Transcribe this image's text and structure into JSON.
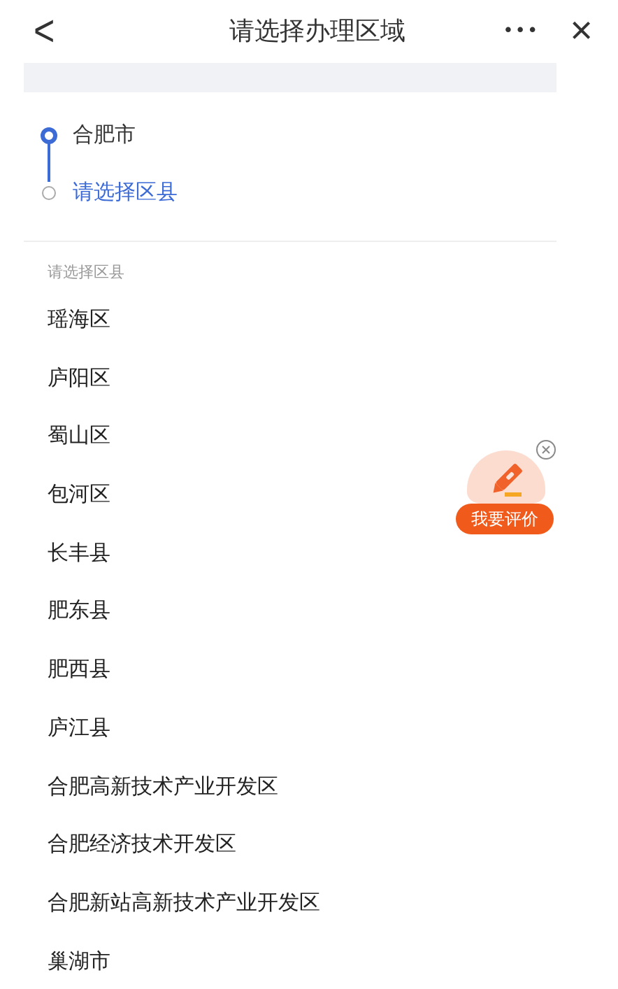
{
  "header": {
    "back": "<",
    "title": "请选择办理区域",
    "more": "•••",
    "close": "×"
  },
  "steps": [
    {
      "label": "合肥市",
      "selected": false
    },
    {
      "label": "请选择区县",
      "selected": true
    }
  ],
  "list": {
    "heading": "请选择区县",
    "items": [
      {
        "label": "瑶海区"
      },
      {
        "label": "庐阳区"
      },
      {
        "label": "蜀山区"
      },
      {
        "label": "包河区"
      },
      {
        "label": "长丰县"
      },
      {
        "label": "肥东县"
      },
      {
        "label": "肥西县"
      },
      {
        "label": "庐江县"
      },
      {
        "label": "合肥高新技术产业开发区"
      },
      {
        "label": "合肥经济技术开发区"
      },
      {
        "label": "合肥新站高新技术产业开发区"
      },
      {
        "label": "巢湖市"
      }
    ]
  },
  "feedback": {
    "label": "我要评价"
  }
}
